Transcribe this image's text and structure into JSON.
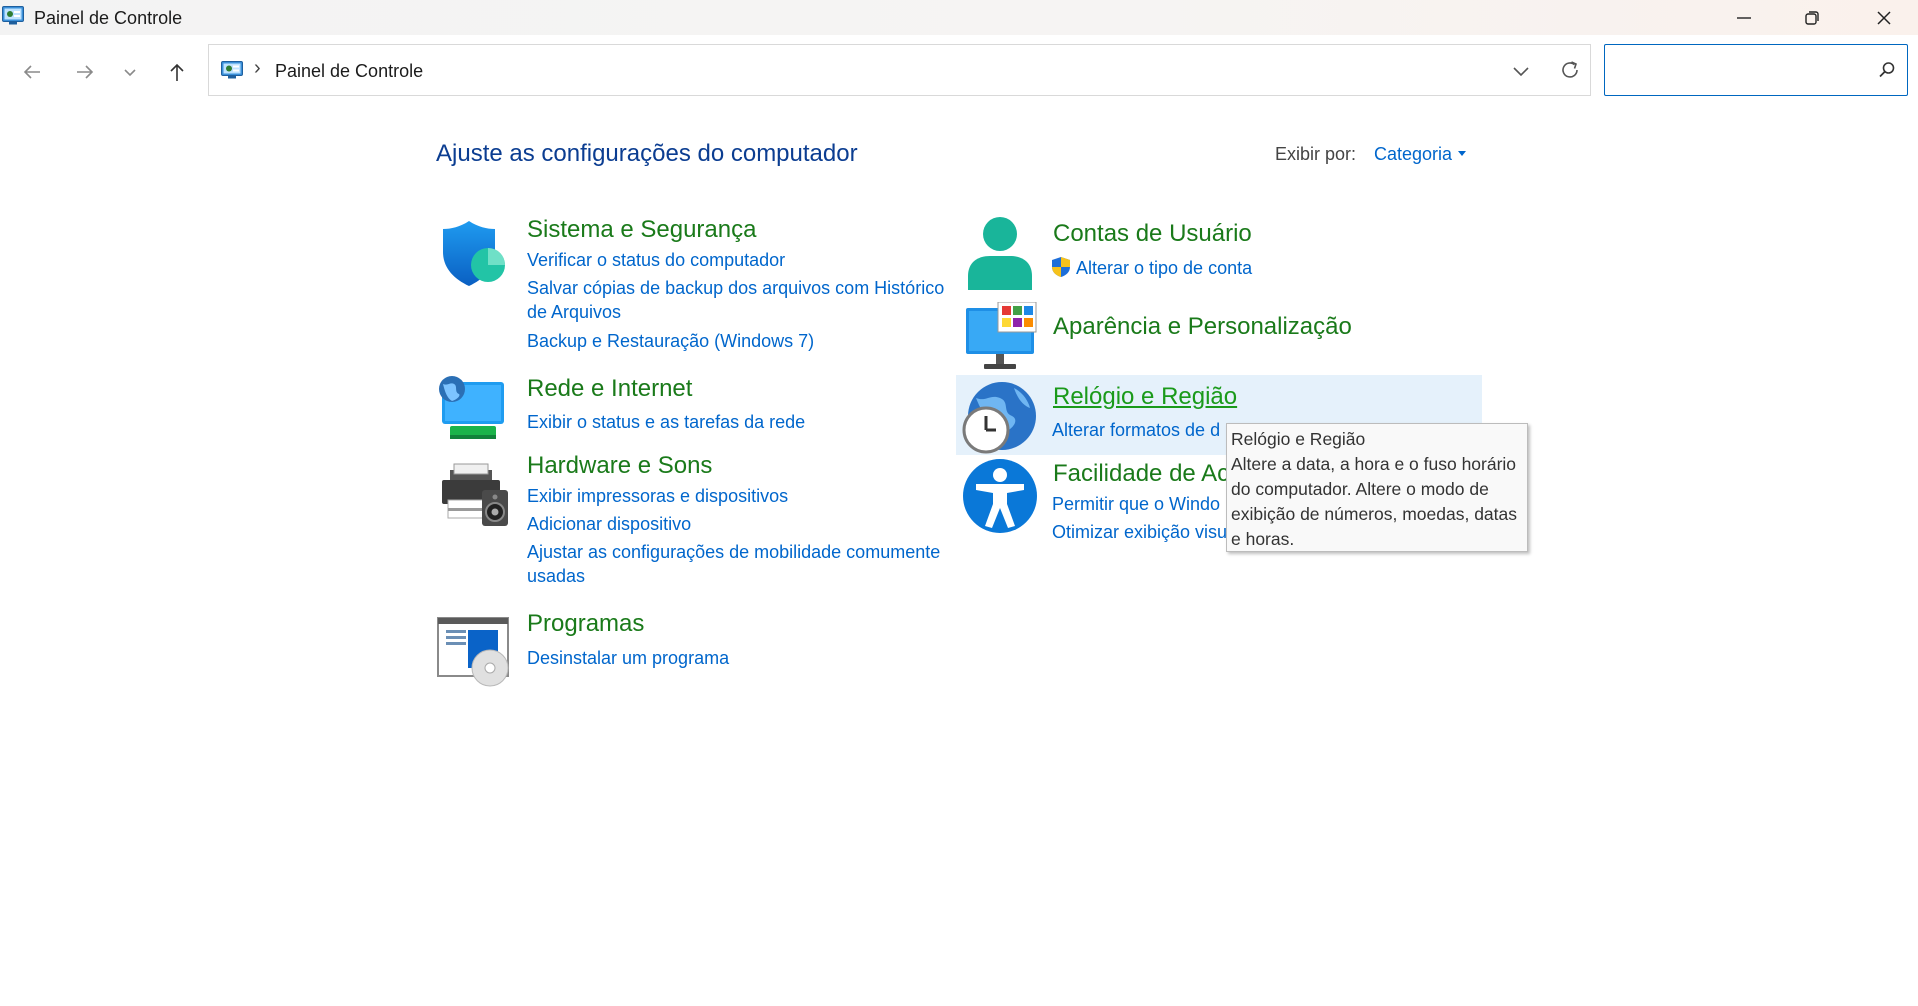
{
  "window": {
    "title": "Painel de Controle"
  },
  "address_bar": {
    "breadcrumb": "Painel de Controle"
  },
  "search": {
    "placeholder": "",
    "value": ""
  },
  "header": {
    "title": "Ajuste as configurações do computador",
    "view_by_label": "Exibir por:",
    "view_by_value": "Categoria"
  },
  "categories": [
    {
      "title": "Sistema e Segurança",
      "icon": "shield-icon",
      "links": [
        "Verificar o status do computador",
        "Salvar cópias de backup dos arquivos com Histórico de Arquivos",
        "Backup e Restauração (Windows 7)"
      ]
    },
    {
      "title": "Rede e Internet",
      "icon": "network-globe-icon",
      "links": [
        "Exibir o status e as tarefas da rede"
      ]
    },
    {
      "title": "Hardware e Sons",
      "icon": "printer-speaker-icon",
      "links": [
        "Exibir impressoras e dispositivos",
        "Adicionar dispositivo",
        "Ajustar as configurações de mobilidade comumente usadas"
      ]
    },
    {
      "title": "Programas",
      "icon": "programs-disc-icon",
      "links": [
        "Desinstalar um programa"
      ]
    },
    {
      "title": "Contas de Usuário",
      "icon": "user-icon",
      "links": [
        "Alterar o tipo de conta"
      ]
    },
    {
      "title": "Aparência e Personalização",
      "icon": "monitor-colors-icon",
      "links": []
    },
    {
      "title": "Relógio e Região",
      "icon": "globe-clock-icon",
      "links": [
        "Alterar formatos de d"
      ]
    },
    {
      "title": "Facilidade de Ac",
      "icon": "accessibility-icon",
      "links": [
        "Permitir que o Windo",
        "Otimizar exibição visu"
      ]
    }
  ],
  "tooltip": {
    "title": "Relógio e Região",
    "text": "Altere a data, a hora e o fuso horário do computador. Altere o modo de exibição de números, moedas, datas e horas."
  },
  "colors": {
    "category_title": "#1a7a1a",
    "link": "#0066cc",
    "page_title": "#0b3d91",
    "hover_background": "#e5f1fb",
    "search_border": "#0067c0"
  }
}
